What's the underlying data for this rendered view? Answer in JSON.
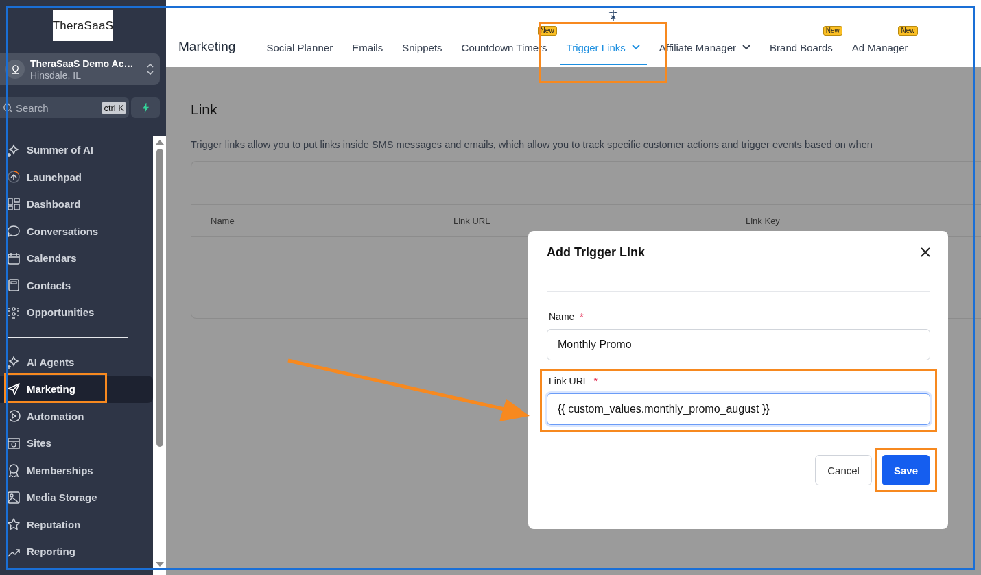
{
  "sidebar": {
    "logo": "TheraSaaS",
    "account": {
      "name": "TheraSaaS Demo Ac…",
      "location": "Hinsdale, IL"
    },
    "search": {
      "placeholder": "Search",
      "shortcut": "ctrl K"
    },
    "sections": [
      {
        "items": [
          {
            "label": "Summer of AI",
            "selected": false,
            "highlighted": false
          },
          {
            "label": "Launchpad",
            "selected": false,
            "highlighted": false
          },
          {
            "label": "Dashboard",
            "selected": false,
            "highlighted": false
          },
          {
            "label": "Conversations",
            "selected": false,
            "highlighted": false
          },
          {
            "label": "Calendars",
            "selected": false,
            "highlighted": false
          },
          {
            "label": "Contacts",
            "selected": false,
            "highlighted": false
          },
          {
            "label": "Opportunities",
            "selected": false,
            "highlighted": false
          }
        ]
      },
      {
        "items": [
          {
            "label": "AI Agents",
            "selected": false,
            "highlighted": false
          },
          {
            "label": "Marketing",
            "selected": true,
            "highlighted": true
          },
          {
            "label": "Automation",
            "selected": false,
            "highlighted": false
          },
          {
            "label": "Sites",
            "selected": false,
            "highlighted": false
          },
          {
            "label": "Memberships",
            "selected": false,
            "highlighted": false
          },
          {
            "label": "Media Storage",
            "selected": false,
            "highlighted": false
          },
          {
            "label": "Reputation",
            "selected": false,
            "highlighted": false
          },
          {
            "label": "Reporting",
            "selected": false,
            "highlighted": false
          }
        ]
      }
    ]
  },
  "topbar": {
    "title": "Marketing",
    "tabs": [
      {
        "label": "Social Planner",
        "selected": false,
        "dropdown": false
      },
      {
        "label": "Emails",
        "selected": false,
        "dropdown": false
      },
      {
        "label": "Snippets",
        "selected": false,
        "dropdown": false
      },
      {
        "label": "Countdown Timers",
        "selected": false,
        "dropdown": false,
        "badge": "New"
      },
      {
        "label": "Trigger Links",
        "selected": true,
        "dropdown": true,
        "highlighted": true
      },
      {
        "label": "Affiliate Manager",
        "selected": false,
        "dropdown": true
      },
      {
        "label": "Brand Boards",
        "selected": false,
        "dropdown": false,
        "badge": "New"
      },
      {
        "label": "Ad Manager",
        "selected": false,
        "dropdown": false,
        "badge": "New"
      }
    ]
  },
  "page": {
    "heading": "Link",
    "description": "Trigger links allow you to put links inside SMS messages and emails, which allow you to track specific customer actions and trigger events based on when",
    "table": {
      "columns": [
        "Name",
        "Link URL",
        "Link Key"
      ]
    }
  },
  "modal": {
    "title": "Add Trigger Link",
    "fields": [
      {
        "label": "Name",
        "required_mark": "*",
        "value": "Monthly Promo",
        "focused": false
      },
      {
        "label": "Link URL",
        "required_mark": "*",
        "value": "{{ custom_values.monthly_promo_august }}",
        "focused": true,
        "highlighted": true
      }
    ],
    "buttons": [
      {
        "label": "Cancel",
        "kind": "secondary"
      },
      {
        "label": "Save",
        "kind": "primary",
        "highlighted": true
      }
    ]
  }
}
